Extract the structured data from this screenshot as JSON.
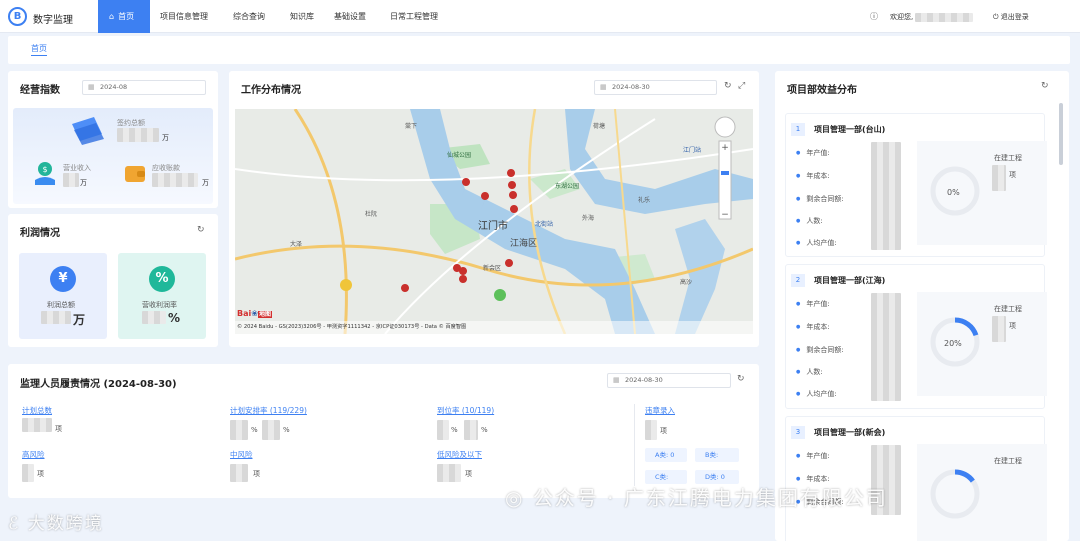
{
  "app": {
    "title": "数字监理",
    "logo_letter": "B"
  },
  "nav": {
    "items": [
      {
        "label": "首页",
        "active": true
      },
      {
        "label": "项目信息管理"
      },
      {
        "label": "综合查询"
      },
      {
        "label": "知识库"
      },
      {
        "label": "基础设置"
      },
      {
        "label": "日常工程管理"
      }
    ]
  },
  "header": {
    "welcome": "欢迎您,",
    "logout": "退出登录"
  },
  "breadcrumb": {
    "home": "首页"
  },
  "business": {
    "title": "经营指数",
    "date": "2024-08",
    "contract_label": "签约总额",
    "contract_unit": "万",
    "revenue_label": "营业收入",
    "revenue_unit": "万",
    "receivable_label": "应收账款",
    "receivable_unit": "万"
  },
  "profit": {
    "title": "利润情况",
    "total_label": "利润总额",
    "total_unit": "万",
    "rate_label": "营收利润率",
    "rate_unit": "%"
  },
  "workmap": {
    "title": "工作分布情况",
    "date": "2024-08-30",
    "city_label": "江门市",
    "district_label": "江海区",
    "attribution": "© 2024 Baidu - GS(2023)3206号 - 甲测资字1111342 - 京ICP证030173号 - Data © 百度智图",
    "baidu_logo": "Bai",
    "baidu_logo_suffix": "地图",
    "place_names": [
      "仙城公园",
      "东湖公园",
      "江门站",
      "礼乐",
      "外海",
      "高沙",
      "荷塘",
      "棠下",
      "杜阮",
      "大泽",
      "新会区",
      "北街站"
    ]
  },
  "projects": {
    "title": "项目部效益分布",
    "field_labels": [
      "年产值:",
      "年成本:",
      "剩余合同额:",
      "人数:",
      "人均产值:"
    ],
    "status_label": "在建工程",
    "status_unit": "项",
    "items": [
      {
        "num": "1",
        "name": "项目管理一部(台山)",
        "percent": "0%",
        "pct_value": 0
      },
      {
        "num": "2",
        "name": "项目管理一部(江海)",
        "percent": "20%",
        "pct_value": 20
      },
      {
        "num": "3",
        "name": "项目管理一部(新会)",
        "percent": "",
        "pct_value": 15
      }
    ]
  },
  "duty": {
    "title": "监理人员履责情况 (2024-08-30)",
    "date": "2024-08-30",
    "plan_total": "计划总数",
    "plan_rate": "计划安排率 (119/229)",
    "arrival_rate": "到位率 (10/119)",
    "violation": "违章录入",
    "high_risk": "高风险",
    "mid_risk": "中风险",
    "low_risk": "低风险及以下",
    "unit_item": "项",
    "unit_percent": "%",
    "class_a": "A类: 0",
    "class_b": "B类:",
    "class_c": "C类:",
    "class_d": "D类: 0"
  },
  "watermarks": {
    "wechat": "公众号 · 广东江腾电力集团有限公司",
    "corner": "大数跨境"
  },
  "colors": {
    "accent": "#3d80f2",
    "marker": "#c9302c",
    "page_bg": "#eef3fb"
  }
}
